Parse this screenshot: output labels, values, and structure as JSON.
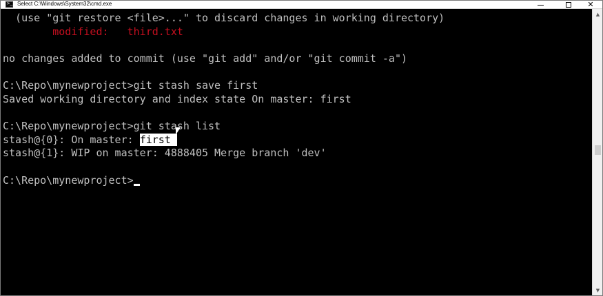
{
  "window": {
    "title": "Select C:\\Windows\\System32\\cmd.exe",
    "icon": "cmd-icon",
    "controls": {
      "minimize_icon": "minimize-icon",
      "maximize_icon": "maximize-icon",
      "close_icon": "close-icon",
      "close_glyph": "✕"
    }
  },
  "console": {
    "colors": {
      "background": "#000000",
      "text": "#c0c0c0",
      "modified": "#c50f1f",
      "selection_bg": "#ffffff",
      "selection_fg": "#000000"
    },
    "lines": [
      {
        "text": "  (use \"git restore <file>...\" to discard changes in working directory)"
      },
      {
        "text": "        modified:   third.txt"
      },
      {
        "text": ""
      },
      {
        "text": "no changes added to commit (use \"git add\" and/or \"git commit -a\")"
      },
      {
        "text": ""
      },
      {
        "text": "C:\\Repo\\mynewproject>git stash save first"
      },
      {
        "text": "Saved working directory and index state On master: first"
      },
      {
        "text": ""
      },
      {
        "text": "C:\\Repo\\mynewproject>git stash list"
      },
      {
        "text_before": "stash@{0}: On master: ",
        "selected": "first "
      },
      {
        "text": "stash@{1}: WIP on master: 4888405 Merge branch 'dev'"
      },
      {
        "text": ""
      },
      {
        "text": "C:\\Repo\\mynewproject>"
      }
    ]
  },
  "scrollbar": {
    "up_arrow": "▲",
    "down_arrow": "▼"
  }
}
